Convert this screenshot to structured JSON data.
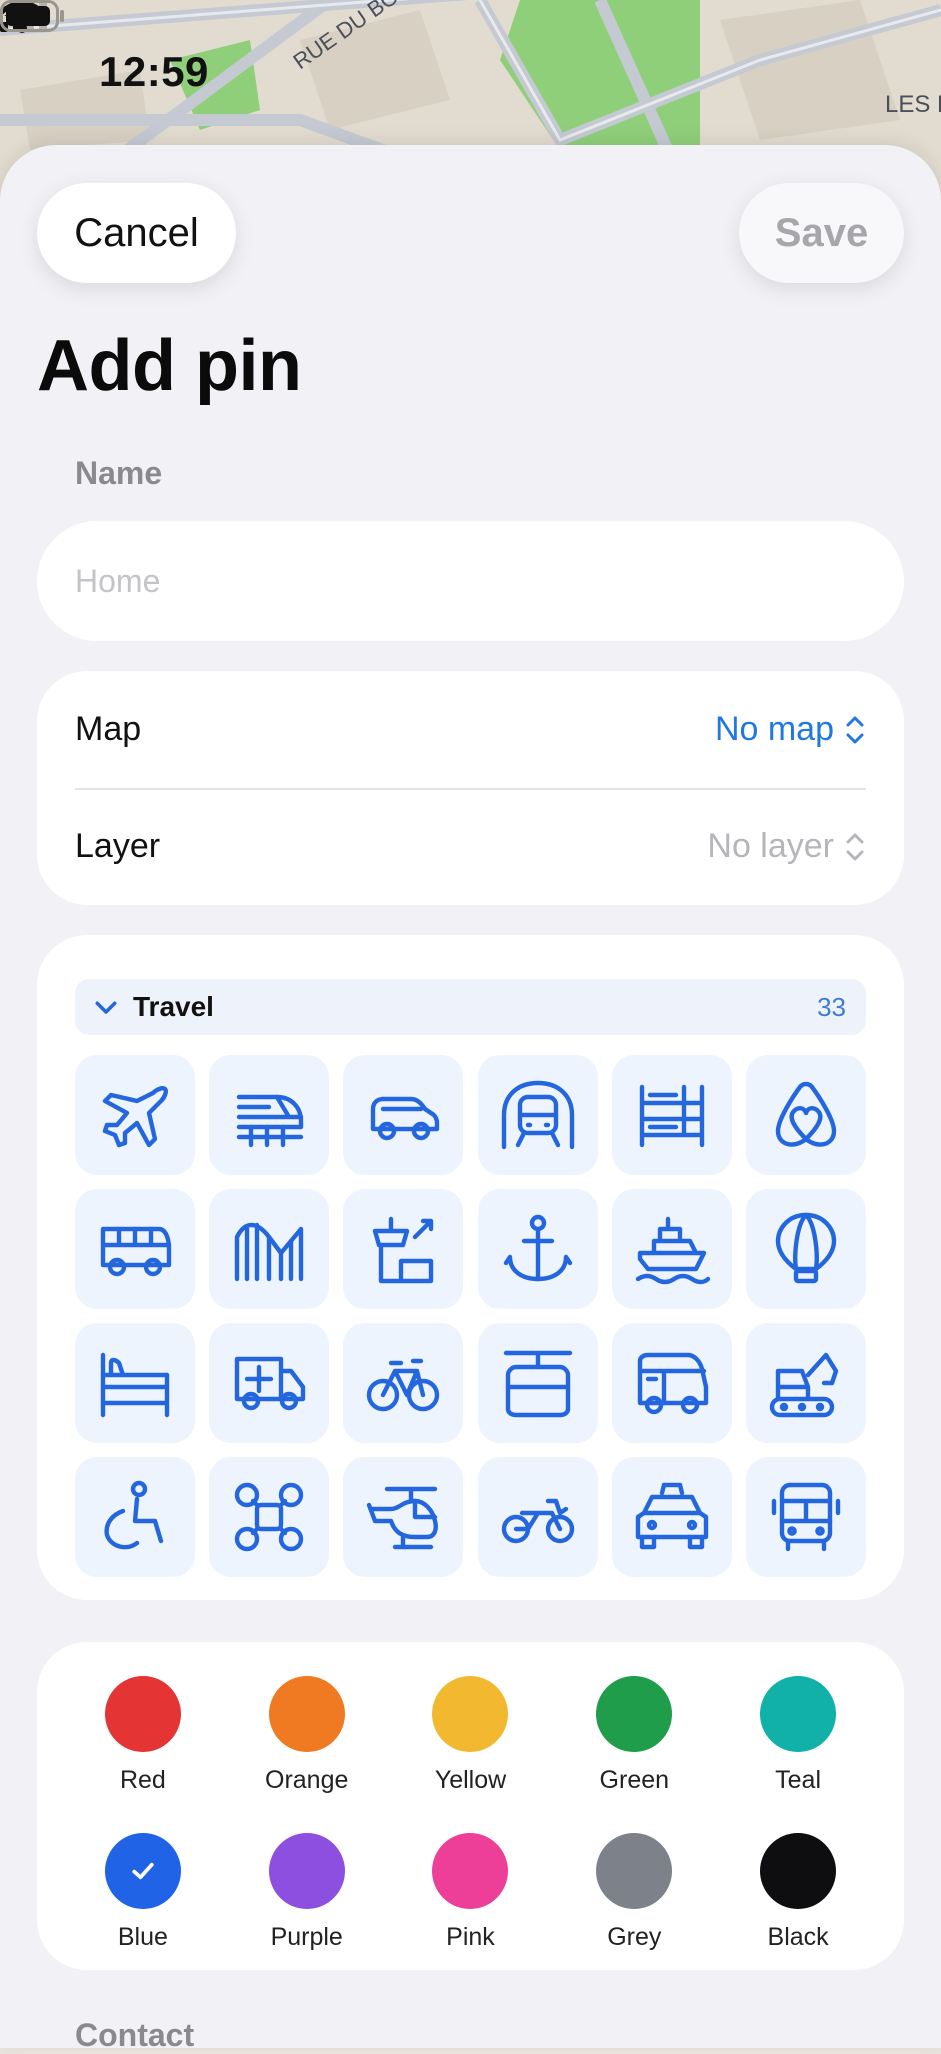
{
  "status": {
    "time": "12:59"
  },
  "map_labels": {
    "street": "RUE DU BO",
    "corner": "LES H"
  },
  "header": {
    "cancel_label": "Cancel",
    "save_label": "Save",
    "title": "Add pin"
  },
  "name_field": {
    "label": "Name",
    "placeholder": "Home",
    "value": ""
  },
  "selectors": {
    "map": {
      "label": "Map",
      "value": "No map"
    },
    "layer": {
      "label": "Layer",
      "value": "No layer"
    }
  },
  "icon_category": {
    "name": "Travel",
    "count": "33",
    "icons": [
      "airplane-icon",
      "train-icon",
      "car-icon",
      "subway-icon",
      "bunk-bed-icon",
      "airbnb-icon",
      "bus-icon",
      "roller-coaster-icon",
      "control-tower-icon",
      "anchor-icon",
      "ship-icon",
      "hot-air-balloon-icon",
      "bed-icon",
      "ambulance-icon",
      "bicycle-icon",
      "cable-car-icon",
      "camper-van-icon",
      "excavator-icon",
      "wheelchair-icon",
      "drone-icon",
      "helicopter-icon",
      "motorcycle-icon",
      "taxi-icon",
      "bus-front-icon"
    ]
  },
  "colors": [
    {
      "name": "Red",
      "hex": "#e53434",
      "selected": false
    },
    {
      "name": "Orange",
      "hex": "#f07a22",
      "selected": false
    },
    {
      "name": "Yellow",
      "hex": "#f2b930",
      "selected": false
    },
    {
      "name": "Green",
      "hex": "#1f9d4b",
      "selected": false
    },
    {
      "name": "Teal",
      "hex": "#11b0a8",
      "selected": false
    },
    {
      "name": "Blue",
      "hex": "#2163e6",
      "selected": true
    },
    {
      "name": "Purple",
      "hex": "#8c4fe0",
      "selected": false
    },
    {
      "name": "Pink",
      "hex": "#ee3f98",
      "selected": false
    },
    {
      "name": "Grey",
      "hex": "#7d8189",
      "selected": false
    },
    {
      "name": "Black",
      "hex": "#0e0e10",
      "selected": false
    }
  ],
  "contact_label": "Contact"
}
